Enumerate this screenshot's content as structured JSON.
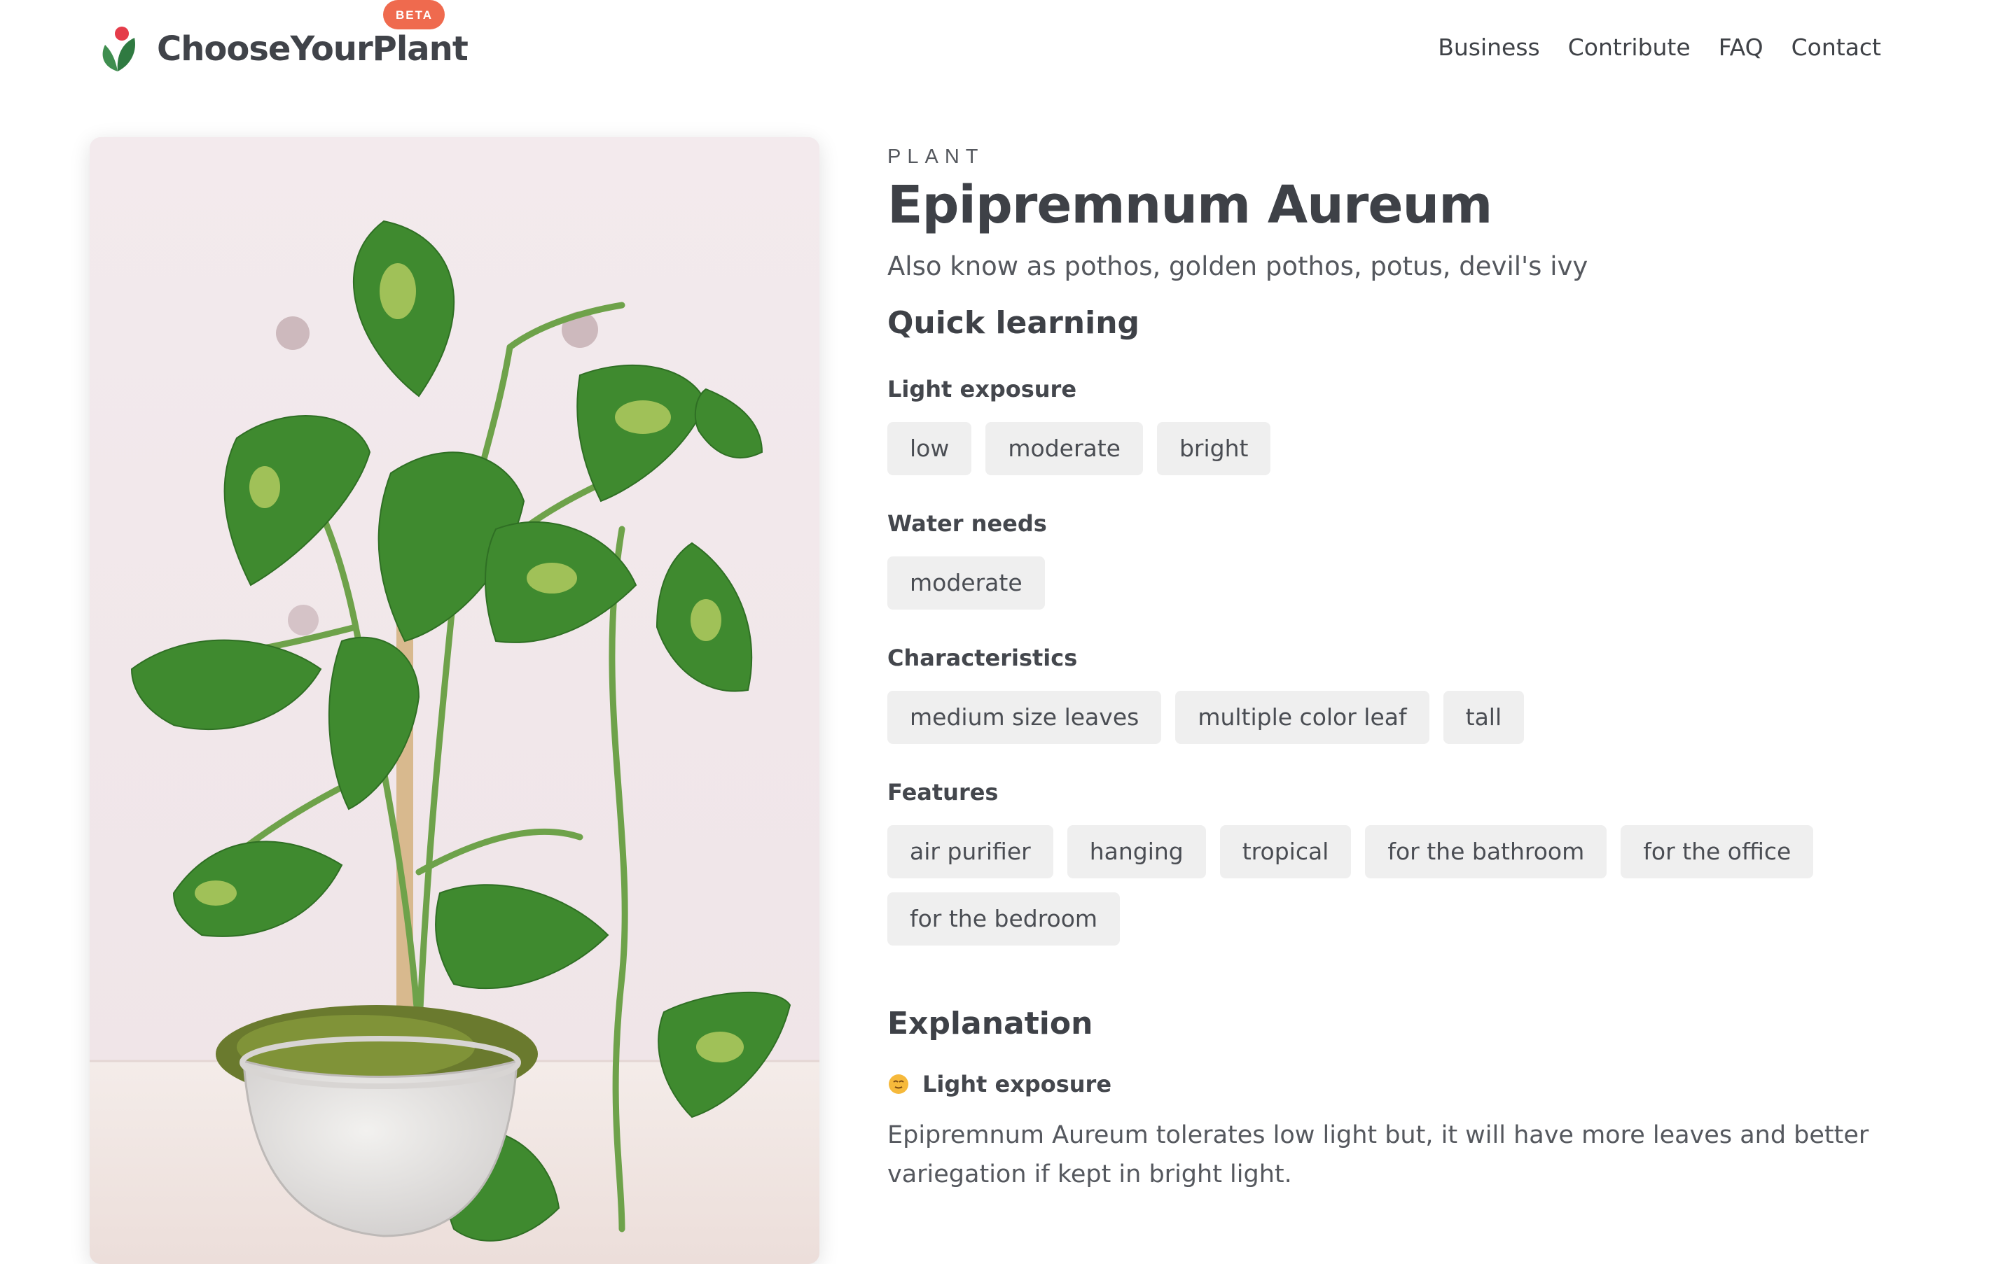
{
  "header": {
    "brand": "ChooseYourPlant",
    "badge": "BETA",
    "nav": [
      "Business",
      "Contribute",
      "FAQ",
      "Contact"
    ]
  },
  "plant": {
    "kicker": "PLANT",
    "name": "Epipremnum Aureum",
    "aka": "Also know as pothos, golden pothos, potus, devil's ivy"
  },
  "quick": {
    "title": "Quick learning",
    "groups": [
      {
        "label": "Light exposure",
        "tags": [
          "low",
          "moderate",
          "bright"
        ]
      },
      {
        "label": "Water needs",
        "tags": [
          "moderate"
        ]
      },
      {
        "label": "Characteristics",
        "tags": [
          "medium size leaves",
          "multiple color leaf",
          "tall"
        ]
      },
      {
        "label": "Features",
        "tags": [
          "air purifier",
          "hanging",
          "tropical",
          "for the bathroom",
          "for the office",
          "for the bedroom"
        ]
      }
    ]
  },
  "explanation": {
    "title": "Explanation",
    "item_label": "Light exposure",
    "item_icon": "sun-face-icon",
    "item_text": "Epipremnum Aureum tolerates low light but, it will have more leaves and better variegation if kept in bright light."
  },
  "colors": {
    "accent": "#ef6a4e",
    "tag_bg": "#efefef",
    "text_dark": "#3e4147"
  }
}
